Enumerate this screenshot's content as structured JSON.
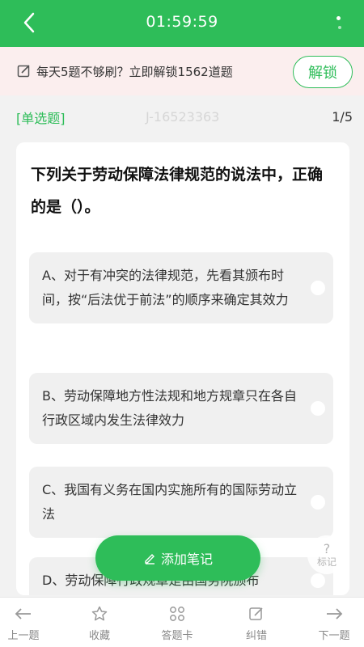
{
  "header": {
    "timer": "01:59:59"
  },
  "promo": {
    "text": "每天5题不够刷？立即解锁1562道题",
    "button_label": "解锁"
  },
  "question_meta": {
    "type_label": "[单选题]",
    "question_id": "J-16523363",
    "progress": "1/5"
  },
  "question": {
    "text": "下列关于劳动保障法律规范的说法中，正确的是（）。",
    "options": [
      {
        "label": "A、对于有冲突的法律规范，先看其颁布时间，按“后法优于前法”的顺序来确定其效力"
      },
      {
        "label": "B、劳动保障地方性法规和地方规章只在各自行政区域内发生法律效力"
      },
      {
        "label": "C、我国有义务在国内实施所有的国际劳动立法"
      },
      {
        "label": "D、劳动保障行政规章是由国务院颁布"
      }
    ]
  },
  "floating": {
    "add_note_label": "添加笔记",
    "mark_icon_text": "?",
    "mark_label": "标记"
  },
  "bottom_nav": {
    "prev": "上一题",
    "favorite": "收藏",
    "answer_card": "答题卡",
    "report_error": "纠错",
    "next": "下一题"
  },
  "colors": {
    "brand_green": "#2ebd59",
    "promo_bg": "#fbeeee"
  }
}
